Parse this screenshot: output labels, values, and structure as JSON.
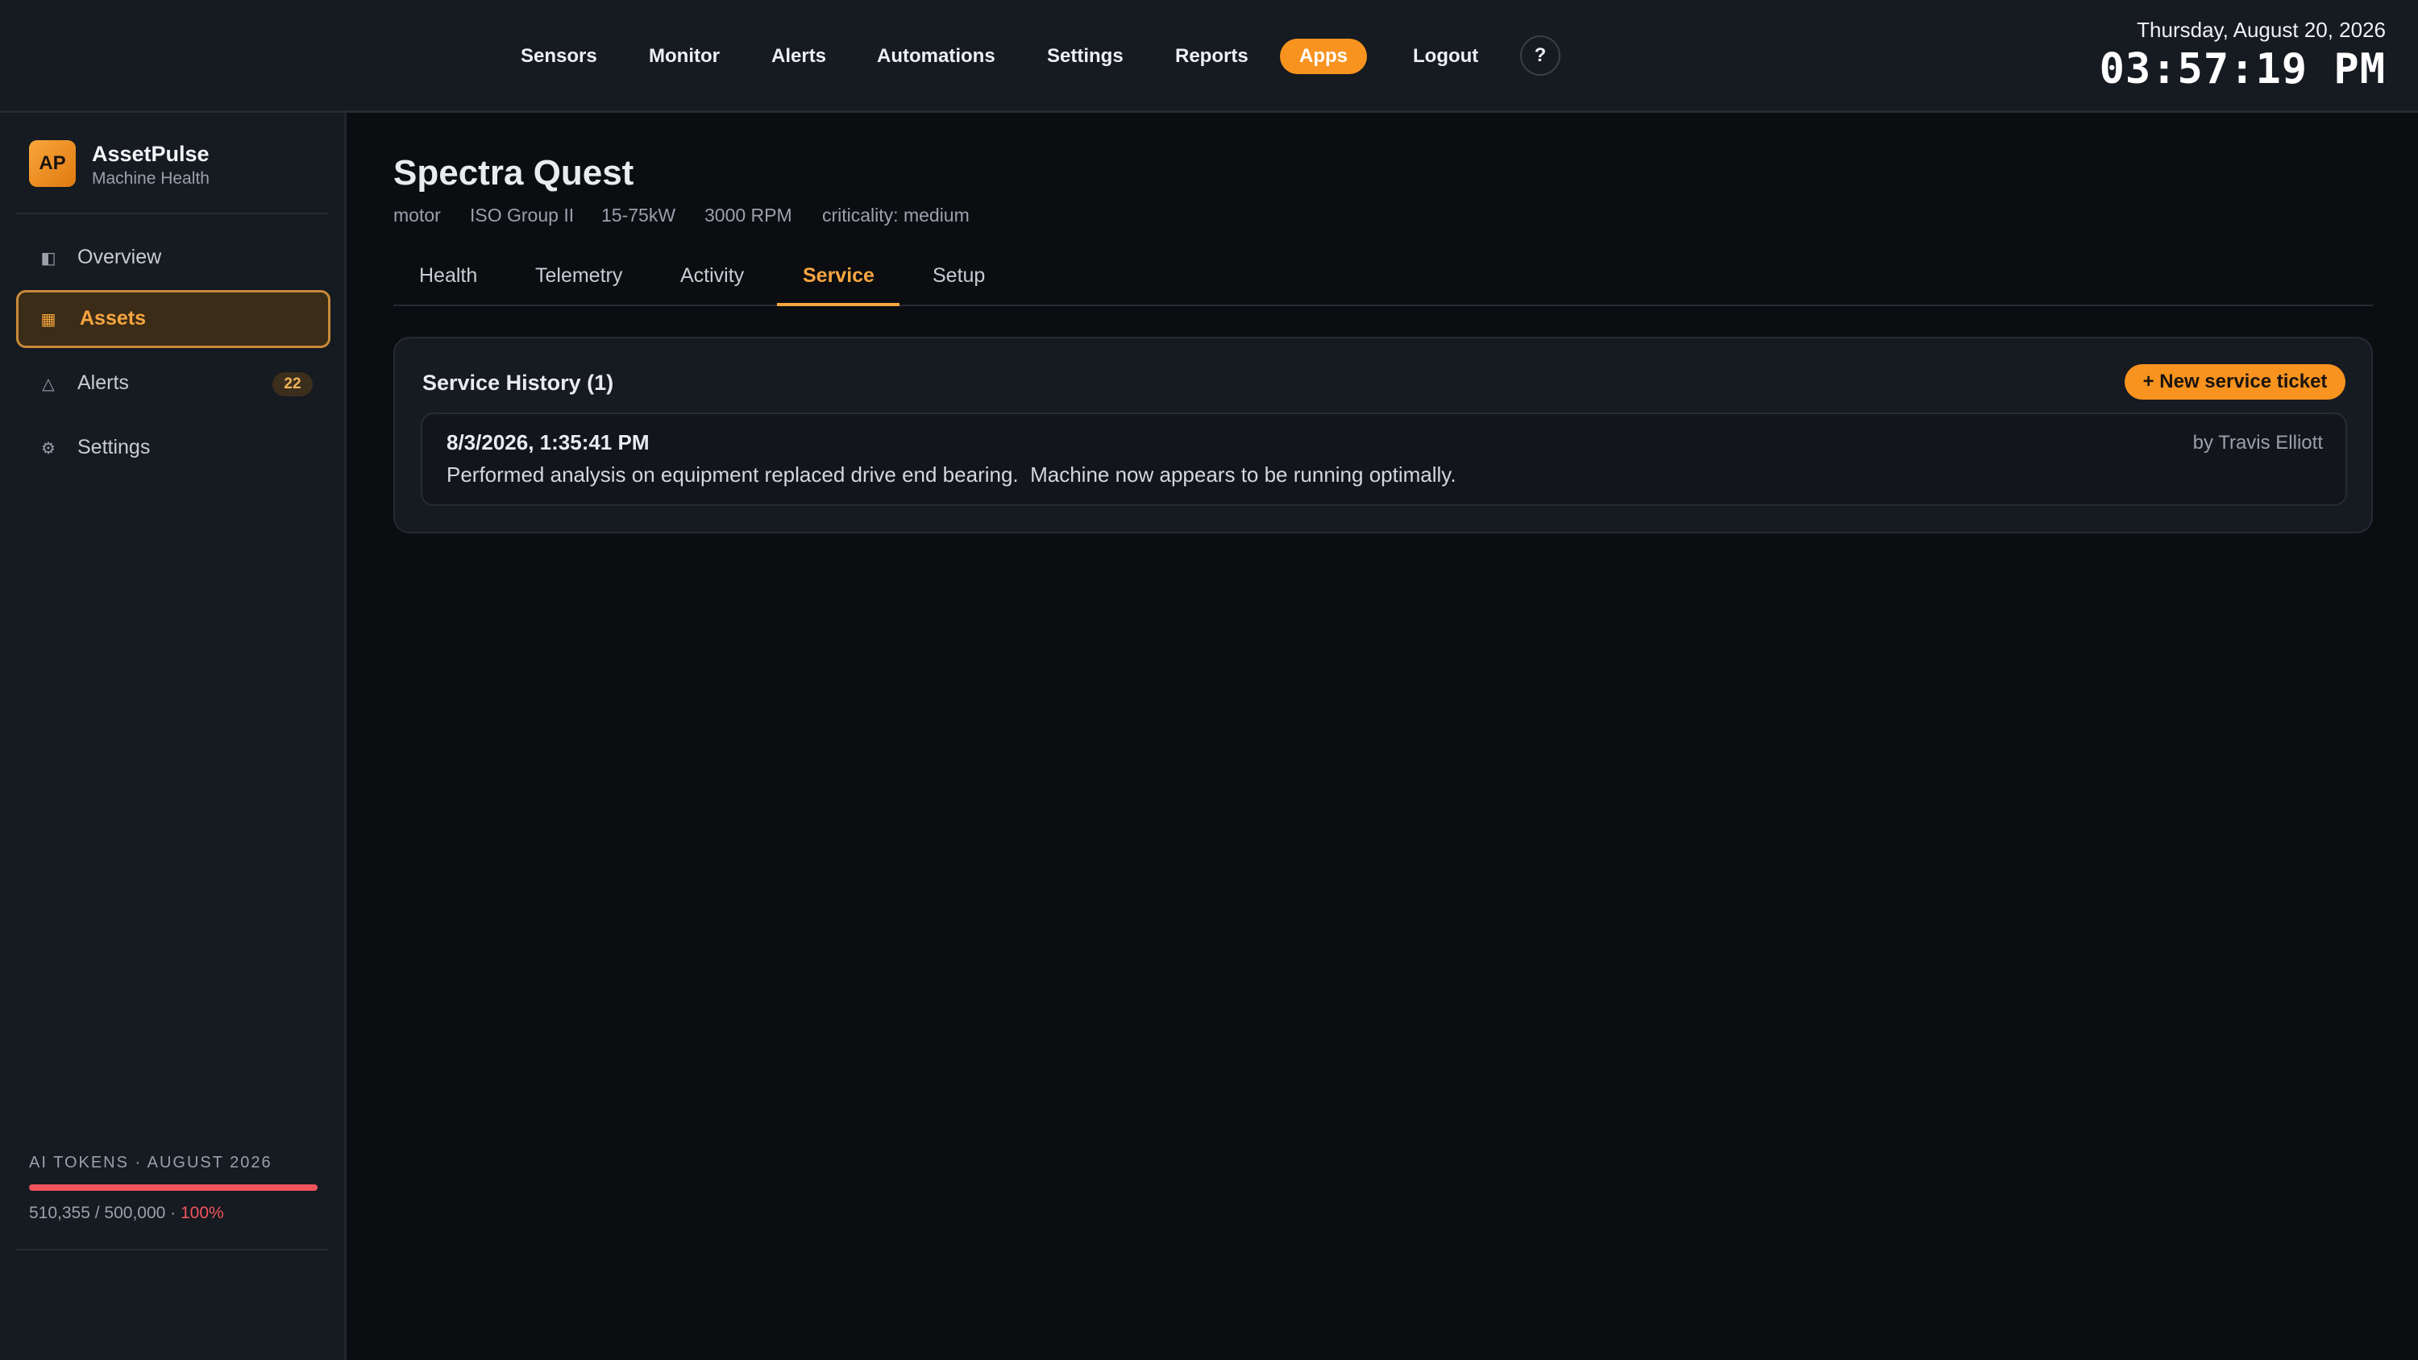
{
  "topnav": {
    "items": [
      "Sensors",
      "Monitor",
      "Alerts",
      "Automations",
      "Settings",
      "Reports"
    ],
    "apps_label": "Apps",
    "logout_label": "Logout",
    "help_label": "?"
  },
  "clock": {
    "date": "Thursday, August 20, 2026",
    "time": "03:57:19 PM"
  },
  "brand": {
    "initials": "AP",
    "name": "AssetPulse",
    "subtitle": "Machine Health"
  },
  "sidebar": {
    "items": [
      {
        "label": "Overview",
        "icon": "overview-icon",
        "active": false
      },
      {
        "label": "Assets",
        "icon": "assets-grid-icon",
        "active": true
      },
      {
        "label": "Alerts",
        "icon": "warning-triangle-icon",
        "active": false,
        "badge": "22"
      },
      {
        "label": "Settings",
        "icon": "gear-icon",
        "active": false
      }
    ]
  },
  "usage": {
    "label": "AI TOKENS · AUGUST 2026",
    "used_text": "510,355 / 500,000 · ",
    "percent_text": "100%",
    "fill_fraction": 1.0
  },
  "asset": {
    "title": "Spectra Quest",
    "meta": [
      "motor",
      "ISO Group II",
      "15-75kW",
      "3000 RPM",
      "criticality: medium"
    ]
  },
  "tabs": {
    "items": [
      "Health",
      "Telemetry",
      "Activity",
      "Service",
      "Setup"
    ],
    "active": "Service"
  },
  "service": {
    "title": "Service History (1)",
    "new_button": "+ New service ticket",
    "entries": [
      {
        "date": "8/3/2026, 1:35:41 PM",
        "author": "by Travis Elliott",
        "text": "Performed analysis on equipment replaced drive end bearing.  Machine now appears to be running optimally."
      }
    ]
  },
  "colors": {
    "accent": "#f7931e",
    "danger": "#f2545b",
    "background": "#0b0d11",
    "panel": "#161a21"
  }
}
